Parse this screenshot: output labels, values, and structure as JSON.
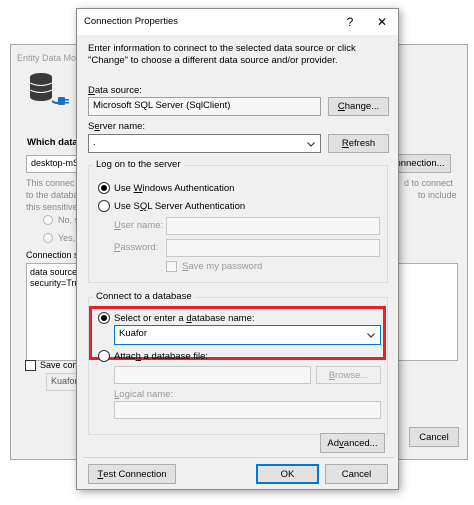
{
  "background_window": {
    "title": "Entity Data Mo",
    "which_data_label": "Which data c",
    "connection_value": "desktop-mSI",
    "new_connection_label": "onnection...",
    "note_left_lines": [
      "This connec",
      "to the databa",
      "this sensitive"
    ],
    "note_right_lines": [
      "d to connect",
      "to include"
    ],
    "option_no": "No, s",
    "option_yes": "Yes, i",
    "connection_string_label": "Connection s",
    "connection_string_lines": [
      "data source=",
      "security=Tru"
    ],
    "save_label": "Save conn",
    "save_value": "Kuafor",
    "cancel_label": "Cancel"
  },
  "dialog": {
    "title": "Connection Properties",
    "help_glyph": "?",
    "close_glyph": "✕",
    "intro_text": "Enter information to connect to the selected data source or click \"Change\" to choose a different data source and/or provider.",
    "data_source_label": "Data source:",
    "data_source_value": "Microsoft SQL Server (SqlClient)",
    "change_button": "Change...",
    "server_name_label": "Server name:",
    "server_name_value": ".",
    "refresh_button": "Refresh",
    "logon_group_title": "Log on to the server",
    "windows_auth_label": "Use Windows Authentication",
    "sql_auth_label": "Use SQL Server Authentication",
    "user_name_label": "User name:",
    "password_label": "Password:",
    "save_password_label": "Save my password",
    "connect_group_title": "Connect to a database",
    "select_db_label": "Select or enter a database name:",
    "db_name_value": "Kuafor",
    "attach_label": "Attach a database file:",
    "browse_button": "Browse...",
    "logical_name_label": "Logical name:",
    "advanced_button": "Advanced...",
    "test_connection_button": "Test Connection",
    "ok_button": "OK",
    "cancel_button": "Cancel",
    "highlight_color": "#e8202b",
    "accent_color": "#0078d7"
  }
}
